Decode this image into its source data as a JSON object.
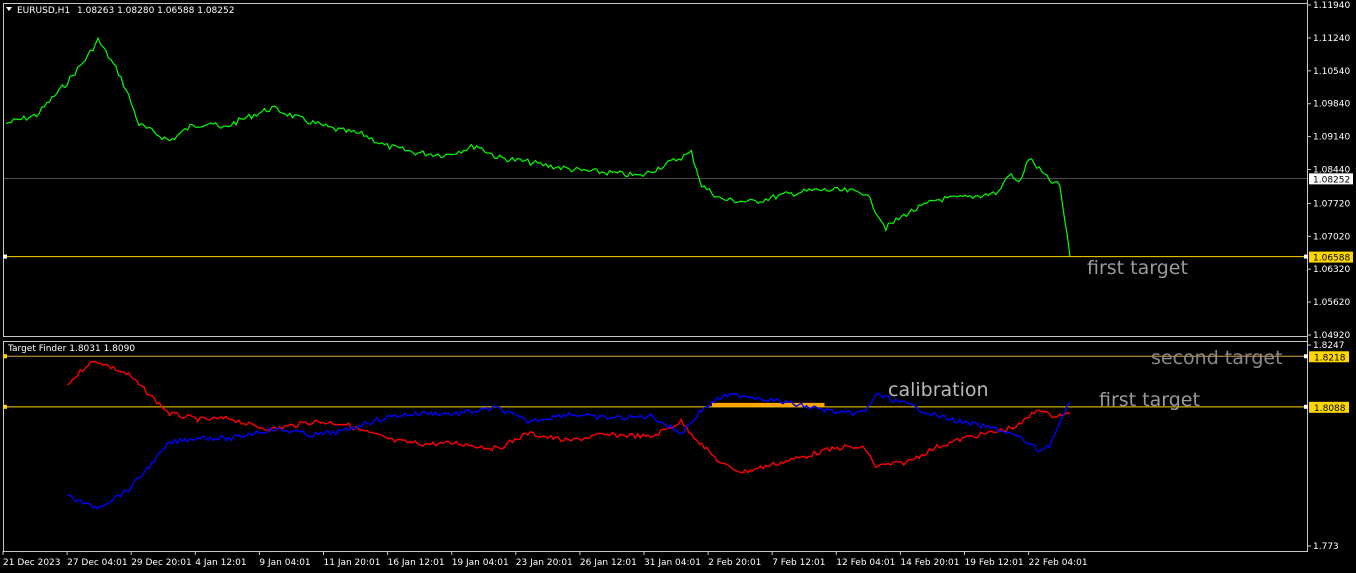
{
  "header": {
    "symbol": "EURUSD,H1",
    "ohlc": "1.08263 1.08280 1.06588 1.08252",
    "indicator": "Target Finder 1.8031 1.8090"
  },
  "annotations": {
    "first_target_top": "first target",
    "second_target": "second target",
    "calibration": "calibration",
    "first_target_bottom": "first target"
  },
  "colors": {
    "price": "#00ff00",
    "red_series": "#ff0000",
    "blue_series": "#0000ff",
    "level_line": "#ffd700",
    "calibration_bar": "#ffa500",
    "grid": "#c0c0c0",
    "background": "#000000"
  },
  "chart_data": [
    {
      "type": "line",
      "panel": "price",
      "title": "",
      "xlabel": "",
      "ylabel": "",
      "ylim": [
        1.0492,
        1.1194
      ],
      "y_ticks": [
        "1.11940",
        "1.11240",
        "1.10540",
        "1.09840",
        "1.09140",
        "1.08440",
        "1.07720",
        "1.07020",
        "1.06320",
        "1.05620",
        "1.04920"
      ],
      "x_ticks": [
        "21 Dec 2023",
        "27 Dec 04:01",
        "29 Dec 20:01",
        "4 Jan 12:01",
        "9 Jan 04:01",
        "11 Jan 20:01",
        "16 Jan 12:01",
        "19 Jan 04:01",
        "23 Jan 20:01",
        "26 Jan 12:01",
        "31 Jan 04:01",
        "2 Feb 20:01",
        "7 Feb 12:01",
        "12 Feb 04:01",
        "14 Feb 20:01",
        "19 Feb 12:01",
        "22 Feb 04:01"
      ],
      "current_price": "1.08252",
      "level_price": "1.06588",
      "series": [
        {
          "color": "#00ff00",
          "points": [
            [
              0,
              1.0942
            ],
            [
              3,
              1.096
            ],
            [
              6,
              1.103
            ],
            [
              8,
              1.1085
            ],
            [
              9,
              1.112
            ],
            [
              10,
              1.1085
            ],
            [
              11,
              1.105
            ],
            [
              12,
              1.1
            ],
            [
              13,
              1.094
            ],
            [
              16,
              1.0905
            ],
            [
              18,
              1.0935
            ],
            [
              20,
              1.0945
            ],
            [
              21,
              1.093
            ],
            [
              23,
              1.095
            ],
            [
              26,
              1.0975
            ],
            [
              29,
              1.095
            ],
            [
              32,
              1.093
            ],
            [
              35,
              1.0918
            ],
            [
              37,
              1.0895
            ],
            [
              40,
              1.088
            ],
            [
              43,
              1.0875
            ],
            [
              46,
              1.0895
            ],
            [
              48,
              1.087
            ],
            [
              51,
              1.086
            ],
            [
              53,
              1.0852
            ],
            [
              56,
              1.0842
            ],
            [
              59,
              1.0837
            ],
            [
              62,
              1.083
            ],
            [
              64,
              1.085
            ],
            [
              67,
              1.088
            ],
            [
              68,
              1.081
            ],
            [
              70,
              1.078
            ],
            [
              73,
              1.0775
            ],
            [
              76,
              1.079
            ],
            [
              79,
              1.08
            ],
            [
              81,
              1.08
            ],
            [
              84,
              1.0795
            ],
            [
              86,
              1.072
            ],
            [
              88,
              1.075
            ],
            [
              91,
              1.078
            ],
            [
              94,
              1.0785
            ],
            [
              97,
              1.0795
            ],
            [
              98,
              1.0835
            ],
            [
              99,
              1.0815
            ],
            [
              100,
              1.0868
            ],
            [
              102,
              1.082
            ],
            [
              103,
              1.081
            ],
            [
              104,
              1.0659
            ]
          ]
        }
      ]
    },
    {
      "type": "line",
      "panel": "indicator",
      "title": "",
      "xlabel": "",
      "ylabel": "",
      "ylim": [
        1.773,
        1.8247
      ],
      "y_ticks": [
        "1.8247",
        "1.773"
      ],
      "levels": [
        "1.8218",
        "1.8088"
      ],
      "calibration_range": [
        69,
        80
      ],
      "series": [
        {
          "color": "#ff0000",
          "points": [
            [
              6,
              1.8145
            ],
            [
              8,
              1.8198
            ],
            [
              9,
              1.8205
            ],
            [
              12,
              1.817
            ],
            [
              14,
              1.812
            ],
            [
              16,
              1.807
            ],
            [
              19,
              1.8055
            ],
            [
              22,
              1.8058
            ],
            [
              24,
              1.804
            ],
            [
              26,
              1.803
            ],
            [
              28,
              1.804
            ],
            [
              30,
              1.805
            ],
            [
              33,
              1.8045
            ],
            [
              35,
              1.8025
            ],
            [
              38,
              1.8
            ],
            [
              41,
              1.7992
            ],
            [
              44,
              1.7995
            ],
            [
              48,
              1.798
            ],
            [
              51,
              1.802
            ],
            [
              55,
              1.8
            ],
            [
              58,
              1.8015
            ],
            [
              61,
              1.8015
            ],
            [
              63,
              1.801
            ],
            [
              66,
              1.805
            ],
            [
              68,
              1.799
            ],
            [
              70,
              1.794
            ],
            [
              72,
              1.792
            ],
            [
              75,
              1.794
            ],
            [
              78,
              1.796
            ],
            [
              80,
              1.7975
            ],
            [
              82,
              1.7985
            ],
            [
              84,
              1.798
            ],
            [
              85,
              1.7935
            ],
            [
              88,
              1.7945
            ],
            [
              91,
              1.7985
            ],
            [
              94,
              1.801
            ],
            [
              97,
              1.8025
            ],
            [
              99,
              1.804
            ],
            [
              101,
              1.8085
            ],
            [
              102,
              1.8065
            ],
            [
              104,
              1.807
            ]
          ]
        },
        {
          "color": "#0000ff",
          "points": [
            [
              6,
              1.786
            ],
            [
              8,
              1.7835
            ],
            [
              9,
              1.783
            ],
            [
              12,
              1.7875
            ],
            [
              14,
              1.7935
            ],
            [
              16,
              1.7995
            ],
            [
              19,
              1.801
            ],
            [
              22,
              1.8005
            ],
            [
              24,
              1.802
            ],
            [
              26,
              1.803
            ],
            [
              28,
              1.8025
            ],
            [
              30,
              1.8015
            ],
            [
              33,
              1.8025
            ],
            [
              35,
              1.8045
            ],
            [
              38,
              1.8065
            ],
            [
              41,
              1.8072
            ],
            [
              44,
              1.807
            ],
            [
              48,
              1.8085
            ],
            [
              51,
              1.805
            ],
            [
              55,
              1.807
            ],
            [
              58,
              1.806
            ],
            [
              61,
              1.806
            ],
            [
              63,
              1.8065
            ],
            [
              66,
              1.802
            ],
            [
              68,
              1.808
            ],
            [
              70,
              1.8115
            ],
            [
              72,
              1.8118
            ],
            [
              75,
              1.8105
            ],
            [
              78,
              1.809
            ],
            [
              80,
              1.808
            ],
            [
              82,
              1.807
            ],
            [
              84,
              1.8075
            ],
            [
              85,
              1.812
            ],
            [
              88,
              1.8095
            ],
            [
              91,
              1.8065
            ],
            [
              94,
              1.8045
            ],
            [
              97,
              1.803
            ],
            [
              99,
              1.801
            ],
            [
              101,
              1.7975
            ],
            [
              102,
              1.799
            ],
            [
              104,
              1.81
            ]
          ]
        }
      ]
    }
  ]
}
